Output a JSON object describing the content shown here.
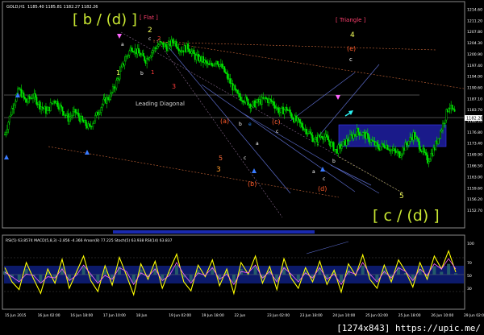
{
  "header": {
    "symbol_label": "GOLD,H1",
    "ohlc_text": "1185.40 1185.81 1182.27 1182.26"
  },
  "indicator_header": {
    "text": "RSI(5) 63.8574  MACD(5,8,3) -2.856 -4.366  Aroon(8) 77.225  Stoch(5) 63.938  RSI(14) 63.837"
  },
  "watermark": "[1274x843] https://upic.me/",
  "chart_data": [
    {
      "type": "candlestick",
      "title": "",
      "symbol": "GOLD",
      "timeframe": "H1",
      "last_price_label": "1182.26",
      "ylim": [
        1148,
        1215
      ],
      "y_ticks": [
        1214.6,
        1211.2,
        1207.8,
        1204.3,
        1200.9,
        1197.4,
        1194.0,
        1190.6,
        1187.1,
        1183.7,
        1180.2,
        1176.8,
        1173.4,
        1169.9,
        1166.5,
        1163.0,
        1159.6,
        1156.2,
        1152.7
      ],
      "x_ticks": [
        "15 Jun 2015",
        "16 Jun 02:00",
        "16 Jun 18:00",
        "17 Jun 10:00",
        "18 Jun",
        "19 Jun 02:00",
        "19 Jun 18:00",
        "22 Jun",
        "23 Jun 02:00",
        "23 Jun 18:00",
        "24 Jun 10:00",
        "25 Jun 02:00",
        "25 Jun 18:00",
        "26 Jun 10:00",
        "29 Jun 02:00"
      ],
      "price_path": [
        1176,
        1184,
        1190,
        1186,
        1188,
        1185,
        1183,
        1187,
        1184,
        1181,
        1183,
        1180,
        1178,
        1182,
        1186,
        1188,
        1193,
        1199,
        1203,
        1201,
        1199,
        1202,
        1204,
        1203,
        1205,
        1202,
        1203,
        1200,
        1199,
        1197,
        1199,
        1196,
        1192,
        1188,
        1187,
        1185,
        1186,
        1187,
        1186,
        1183,
        1184,
        1181,
        1179,
        1177,
        1174,
        1176,
        1174,
        1171,
        1173,
        1175,
        1177,
        1176,
        1174,
        1172,
        1173,
        1171,
        1170,
        1173,
        1176,
        1172,
        1168,
        1172,
        1178,
        1185,
        1182
      ],
      "annotations": [
        {
          "text": "[ b / (d) ]",
          "color": "#c8e632"
        },
        {
          "text": "[ Flat ]",
          "color": "#ff3f6e"
        },
        {
          "text": "[ Triangle ]",
          "color": "#ff3f6e"
        },
        {
          "text": "[ c / (d) ]",
          "color": "#c8e632"
        },
        {
          "text": "Leading Diagonal",
          "color": "#d9d9d9"
        },
        {
          "text": "2",
          "color": "#f3ff5a"
        },
        {
          "text": "1",
          "color": "#f3ff5a"
        },
        {
          "text": "3",
          "color": "#ff9a2a"
        },
        {
          "text": "4",
          "color": "#f3ff5a"
        },
        {
          "text": "5",
          "color": "#f3ff5a"
        },
        {
          "text": "5",
          "color": "#ff6b3a"
        },
        {
          "text": "3",
          "color": "#ff3b3b"
        },
        {
          "text": "1",
          "color": "#ff3b3b"
        },
        {
          "text": "2",
          "color": "#ff3b3b"
        },
        {
          "text": "(a)",
          "color": "#ff5a2a"
        },
        {
          "text": "(b)",
          "color": "#ff5a2a"
        },
        {
          "text": "(c)",
          "color": "#ff5a2a"
        },
        {
          "text": "(d)",
          "color": "#ff5a2a"
        },
        {
          "text": "(e)",
          "color": "#ff5a2a"
        },
        {
          "text": "a",
          "color": "#ffffff"
        },
        {
          "text": "b",
          "color": "#ffffff"
        },
        {
          "text": "c",
          "color": "#ffffff"
        },
        {
          "text": "d",
          "color": "#2a8cff"
        },
        {
          "text": "e",
          "color": "#2a8cff"
        }
      ]
    },
    {
      "type": "line",
      "title": "",
      "ylim": [
        0,
        100
      ],
      "y_ticks": [
        100,
        70,
        50,
        30
      ],
      "series": [
        {
          "color": "#ffff00",
          "values": [
            62,
            40,
            28,
            70,
            45,
            22,
            60,
            38,
            75,
            30,
            55,
            80,
            42,
            25,
            65,
            35,
            78,
            50,
            20,
            68,
            44,
            72,
            30,
            58,
            83,
            40,
            26,
            66,
            48,
            74,
            34,
            60,
            22,
            70,
            52,
            80,
            38,
            64,
            28,
            76,
            46,
            30,
            62,
            40,
            72,
            36,
            58,
            24,
            68,
            50,
            82,
            44,
            30,
            66,
            40,
            74,
            56,
            32,
            70,
            44,
            80,
            60,
            88,
            55
          ]
        },
        {
          "color": "#ff66ff",
          "values": [
            55,
            48,
            40,
            52,
            50,
            38,
            48,
            46,
            60,
            42,
            50,
            66,
            52,
            38,
            50,
            44,
            62,
            56,
            36,
            54,
            48,
            60,
            42,
            50,
            70,
            52,
            38,
            54,
            50,
            62,
            44,
            52,
            36,
            56,
            54,
            66,
            46,
            56,
            40,
            62,
            52,
            40,
            54,
            46,
            62,
            44,
            52,
            36,
            56,
            52,
            70,
            52,
            40,
            56,
            46,
            62,
            56,
            42,
            60,
            50,
            68,
            60,
            76,
            60
          ]
        }
      ]
    }
  ]
}
